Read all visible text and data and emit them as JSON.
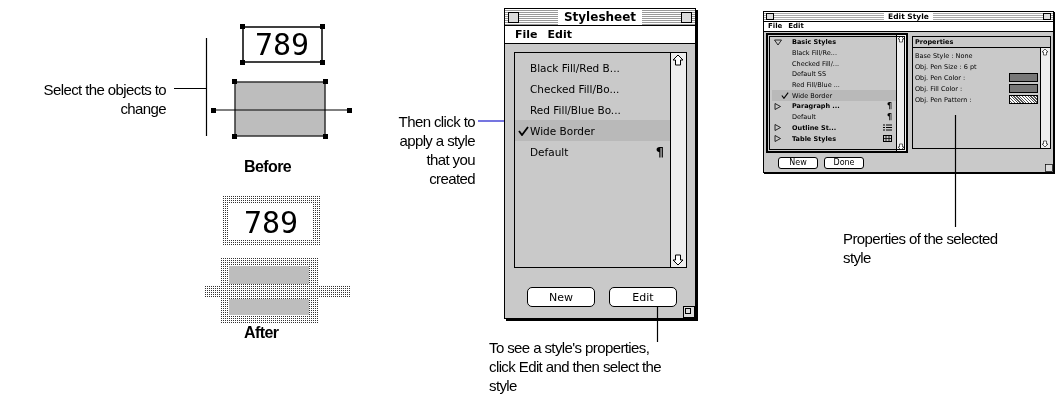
{
  "before_after": {
    "callout": "Select the objects to change",
    "before": {
      "number": "789",
      "label": "Before"
    },
    "after": {
      "number": "789",
      "label": "After"
    }
  },
  "stylesheet_window": {
    "title": "Stylesheet",
    "menu": [
      "File",
      "Edit"
    ],
    "styles": [
      {
        "label": "Black Fill/Red B...",
        "checked": false,
        "selected": false
      },
      {
        "label": "Checked Fill/Bo...",
        "checked": false,
        "selected": false
      },
      {
        "label": "Red Fill/Blue Bo...",
        "checked": false,
        "selected": false
      },
      {
        "label": "Wide Border",
        "checked": true,
        "selected": true
      },
      {
        "label": "Default",
        "checked": false,
        "selected": false,
        "mark": "¶"
      }
    ],
    "buttons": [
      "New",
      "Edit"
    ]
  },
  "apply_callout": "Then click to apply a style that you created",
  "edit_callout": "To see a style's properties, click Edit and then select the style",
  "edit_style_window": {
    "title": "Edit Style",
    "menu": [
      "File",
      "Edit"
    ],
    "tree": [
      {
        "label": "Basic Styles",
        "kind": "basic",
        "expanded": true,
        "children": [
          {
            "label": "Black Fill/Re...",
            "checked": false,
            "selected": false
          },
          {
            "label": "Checked Fill/...",
            "checked": false,
            "selected": false
          },
          {
            "label": "Default SS",
            "checked": false,
            "selected": false
          },
          {
            "label": "Red Fill/Blue ...",
            "checked": false,
            "selected": false
          },
          {
            "label": "Wide Border",
            "checked": true,
            "selected": true
          }
        ]
      },
      {
        "label": "Paragraph ...",
        "kind": "paragraph",
        "mark": "¶",
        "expanded": false,
        "children": [
          {
            "label": "Default",
            "checked": false,
            "selected": false,
            "mark": "¶"
          }
        ]
      },
      {
        "label": "Outline St...",
        "kind": "outline",
        "expanded": false
      },
      {
        "label": "Table Styles",
        "kind": "table",
        "expanded": false
      }
    ],
    "properties": {
      "title": "Properties",
      "rows": [
        {
          "label": "Base Style : None",
          "kind": "text"
        },
        {
          "label": "Obj. Pen Size : 6 pt",
          "kind": "text"
        },
        {
          "label": "Obj. Pen Color :",
          "kind": "swatch"
        },
        {
          "label": "Obj. Fill Color :",
          "kind": "swatch"
        },
        {
          "label": "Obj. Pen Pattern :",
          "kind": "pattern"
        }
      ]
    },
    "buttons": [
      "New",
      "Done"
    ]
  },
  "properties_callout": "Properties of the selected style"
}
